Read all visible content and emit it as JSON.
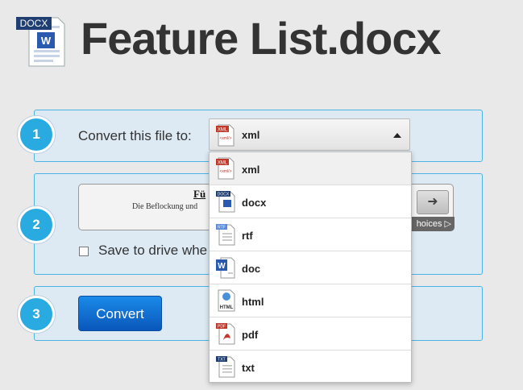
{
  "header": {
    "icon_badge": "DOCX",
    "title": "Feature List.docx"
  },
  "steps": {
    "one": {
      "number": "1",
      "label": "Convert this file to:",
      "selected": "xml",
      "selected_icon": "xml-file-icon"
    },
    "two": {
      "number": "2",
      "options_title": "Fü",
      "options_subtitle": "Die Beflockung und",
      "choices_label": "hoices ▷",
      "save_label": "Save to drive whe"
    },
    "three": {
      "number": "3",
      "convert_label": "Convert"
    }
  },
  "dropdown": {
    "items": [
      {
        "label": "xml",
        "icon": "xml-file-icon",
        "badge": "XML",
        "selected": true
      },
      {
        "label": "docx",
        "icon": "docx-file-icon",
        "badge": "DOCX"
      },
      {
        "label": "rtf",
        "icon": "rtf-file-icon",
        "badge": "RTF"
      },
      {
        "label": "doc",
        "icon": "doc-file-icon",
        "badge": "W"
      },
      {
        "label": "html",
        "icon": "html-file-icon",
        "badge": "HTML"
      },
      {
        "label": "pdf",
        "icon": "pdf-file-icon",
        "badge": "PDF"
      },
      {
        "label": "txt",
        "icon": "txt-file-icon",
        "badge": "TXT"
      }
    ]
  },
  "colors": {
    "accent": "#29abe2",
    "box_bg": "#ddeaf4",
    "box_border": "#4ab4e6",
    "button": "#0d6ad2"
  }
}
